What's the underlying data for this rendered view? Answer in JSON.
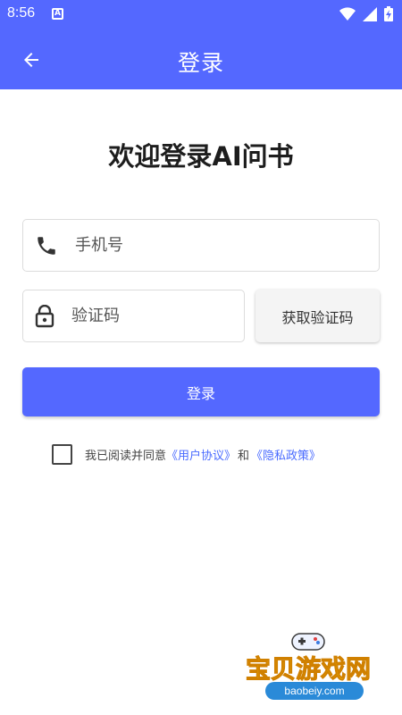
{
  "status_bar": {
    "time": "8:56",
    "app_icon_letter": "A"
  },
  "app_bar": {
    "title": "登录"
  },
  "welcome": "欢迎登录AI问书",
  "form": {
    "phone_placeholder": "手机号",
    "code_placeholder": "验证码",
    "get_code_label": "获取验证码",
    "login_label": "登录"
  },
  "agreement": {
    "prefix": "我已阅读并同意",
    "user_agreement": "《用户协议》",
    "and": "和",
    "privacy_policy": "《隐私政策》"
  },
  "watermark": {
    "title": "宝贝游戏网",
    "url": "baobeiy.com"
  },
  "colors": {
    "primary": "#5468ff",
    "link": "#4a6bff"
  }
}
